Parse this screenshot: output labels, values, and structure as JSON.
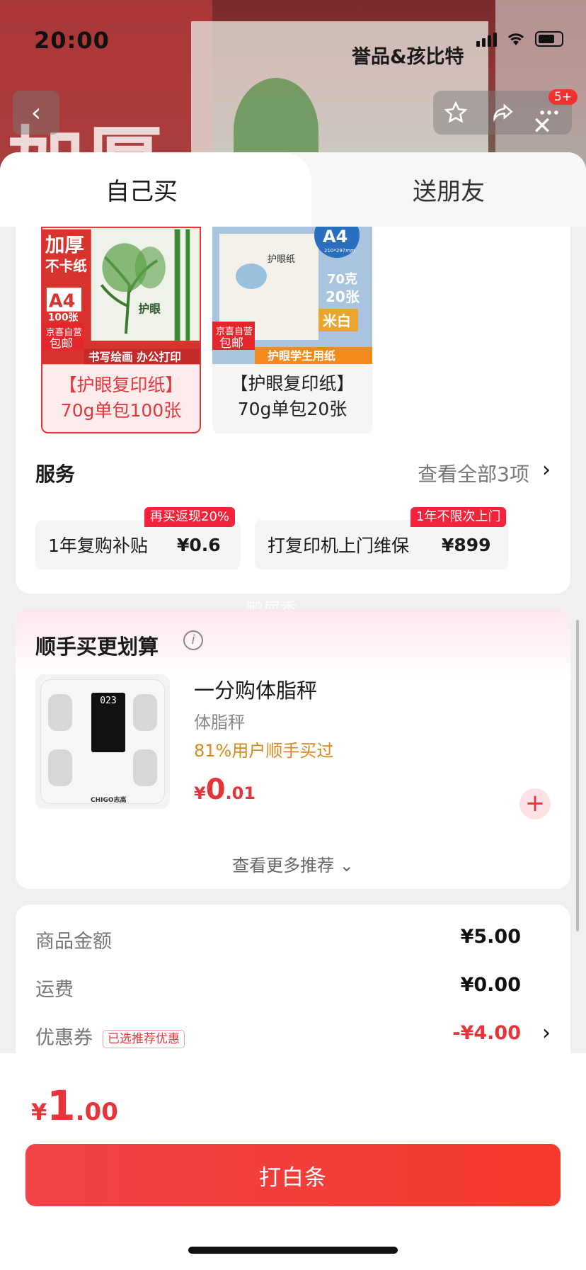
{
  "status": {
    "time": "20:00"
  },
  "header": {
    "brand": "誉品&孩比特",
    "badge": "5+",
    "big_text": "加厚"
  },
  "tabs": {
    "self_buy": "自己买",
    "gift": "送朋友"
  },
  "variants": [
    {
      "label_line1": "【护眼复印纸】",
      "label_line2": "70g单包100张",
      "selected": true,
      "img": {
        "title": "加厚",
        "sub": "不卡纸",
        "size": "A4",
        "count": "100张",
        "badge1": "京喜自营",
        "badge2": "包邮",
        "strip": "书写绘画 办公打印",
        "brand": "护眼"
      }
    },
    {
      "label_line1": "【护眼复印纸】",
      "label_line2": "70g单包20张",
      "selected": false,
      "img": {
        "size": "A4",
        "size_sub": "210*297mm",
        "weight": "70克",
        "count": "20张",
        "color": "米白",
        "paper": "护眼纸",
        "badge1": "京喜自营",
        "badge2": "包邮",
        "strip": "护眼学生用纸"
      }
    }
  ],
  "services": {
    "title": "服务",
    "more": "查看全部3项",
    "items": [
      {
        "name": "1年复购补贴",
        "price": "¥0.6",
        "tag": "再买返现20%"
      },
      {
        "name": "打复印机上门维保",
        "price": "¥899",
        "tag": "1年不限次上门"
      }
    ]
  },
  "watermark": "鸭屎香",
  "recommend": {
    "title": "顺手买更划算",
    "product": {
      "name": "一分购体脂秤",
      "category": "体脂秤",
      "buy_rate": "81%用户顺手买过",
      "price_symbol": "¥",
      "price_int": "0",
      "price_dec": ".01",
      "screen_value": "023",
      "logo": "CHIGO志高"
    },
    "more": "查看更多推荐"
  },
  "summary": {
    "goods_label": "商品金额",
    "goods_value": "¥5.00",
    "shipping_label": "运费",
    "shipping_value": "¥0.00",
    "coupon_label": "优惠券",
    "coupon_tag": "已选推荐优惠",
    "coupon_value": "-¥4.00"
  },
  "footer": {
    "price_symbol": "¥",
    "price_int": "1",
    "price_dec": ".00",
    "pay_label": "打白条"
  },
  "colors": {
    "accent": "#e6353a",
    "orange": "#d48a1e"
  }
}
